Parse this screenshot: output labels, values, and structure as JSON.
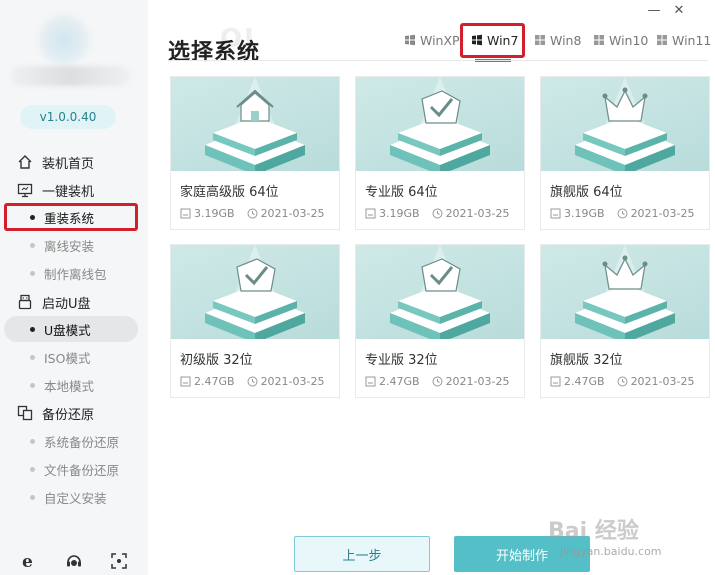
{
  "app": {
    "version": "v1.0.0.40"
  },
  "sidebar": {
    "groups": [
      {
        "label": "装机首页",
        "icon": "home-icon"
      },
      {
        "label": "一键装机",
        "icon": "monitor-icon"
      },
      {
        "label": "启动U盘",
        "icon": "usb-icon"
      },
      {
        "label": "备份还原",
        "icon": "backup-icon"
      }
    ],
    "install_items": [
      {
        "label": "重装系统",
        "active": true
      },
      {
        "label": "离线安装",
        "active": false
      },
      {
        "label": "制作离线包",
        "active": false
      }
    ],
    "usb_items": [
      {
        "label": "U盘模式",
        "active": true
      },
      {
        "label": "ISO模式",
        "active": false
      },
      {
        "label": "本地模式",
        "active": false
      }
    ],
    "backup_items": [
      {
        "label": "系统备份还原"
      },
      {
        "label": "文件备份还原"
      },
      {
        "label": "自定义安装"
      }
    ],
    "bottom_icons": [
      "browser-icon",
      "support-icon",
      "screenshot-icon"
    ]
  },
  "window": {
    "minimize": "—",
    "close": "✕"
  },
  "header": {
    "title": "选择系统",
    "tabs": [
      {
        "label": "WinXP",
        "active": false
      },
      {
        "label": "Win7",
        "active": true
      },
      {
        "label": "Win8",
        "active": false
      },
      {
        "label": "Win10",
        "active": false
      },
      {
        "label": "Win11",
        "active": false
      }
    ]
  },
  "cards": [
    {
      "name": "家庭高级版 64位",
      "size": "3.19GB",
      "date": "2021-03-25",
      "icon": "house-icon"
    },
    {
      "name": "专业版 64位",
      "size": "3.19GB",
      "date": "2021-03-25",
      "icon": "check-icon"
    },
    {
      "name": "旗舰版 64位",
      "size": "3.19GB",
      "date": "2021-03-25",
      "icon": "crown-icon"
    },
    {
      "name": "初级版 32位",
      "size": "2.47GB",
      "date": "2021-03-25",
      "icon": "check-icon"
    },
    {
      "name": "专业版 32位",
      "size": "2.47GB",
      "date": "2021-03-25",
      "icon": "check-icon"
    },
    {
      "name": "旗舰版 32位",
      "size": "2.47GB",
      "date": "2021-03-25",
      "icon": "crown-icon"
    }
  ],
  "buttons": {
    "prev": "上一步",
    "start": "开始制作"
  },
  "watermark": {
    "main": "Bai 经验",
    "sub": "jingyan.baidu.com"
  },
  "colors": {
    "accent": "#55bfc8",
    "highlight": "#d21f2b",
    "card_bg": "#c4e3e1"
  }
}
